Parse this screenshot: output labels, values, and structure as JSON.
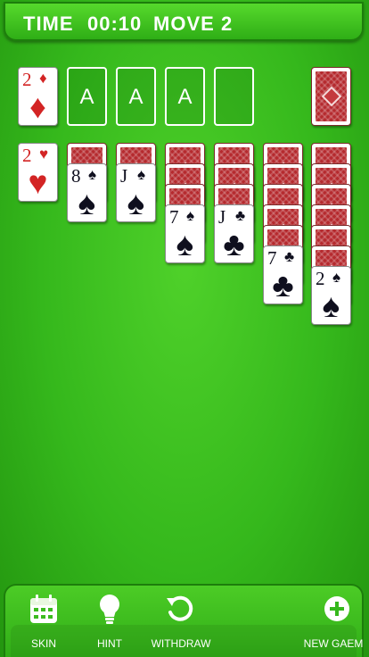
{
  "header": {
    "time_label": "TIME",
    "time_value": "00:10",
    "move_label": "MOVE",
    "move_value": "2"
  },
  "foundations": [
    {
      "rank": "2",
      "suit": "♦",
      "color": "red"
    },
    {
      "label": "A"
    },
    {
      "label": "A"
    },
    {
      "label": "A"
    },
    {
      "label": ""
    }
  ],
  "tableau": [
    {
      "hidden": 0,
      "face_up": [
        {
          "rank": "2",
          "suit": "♥",
          "color": "red"
        }
      ]
    },
    {
      "hidden": 1,
      "face_up": [
        {
          "rank": "8",
          "suit": "♠",
          "color": "black"
        }
      ]
    },
    {
      "hidden": 1,
      "face_up": [
        {
          "rank": "J",
          "suit": "♠",
          "color": "black"
        }
      ]
    },
    {
      "hidden": 3,
      "face_up": [
        {
          "rank": "7",
          "suit": "♠",
          "color": "black"
        }
      ]
    },
    {
      "hidden": 3,
      "face_up": [
        {
          "rank": "J",
          "suit": "♣",
          "color": "black"
        }
      ]
    },
    {
      "hidden": 5,
      "face_up": [
        {
          "rank": "7",
          "suit": "♣",
          "color": "black"
        }
      ]
    },
    {
      "hidden": 6,
      "face_up": [
        {
          "rank": "2",
          "suit": "♠",
          "color": "black"
        }
      ]
    }
  ],
  "toolbar": {
    "skin_label": "SKIN",
    "hint_label": "HINT",
    "withdraw_label": "WITHDRAW",
    "new_game_label": "NEW GAEM"
  },
  "colors": {
    "felt": "#35b81c",
    "card_back": "#b52a2e",
    "red_suit": "#d32424"
  }
}
